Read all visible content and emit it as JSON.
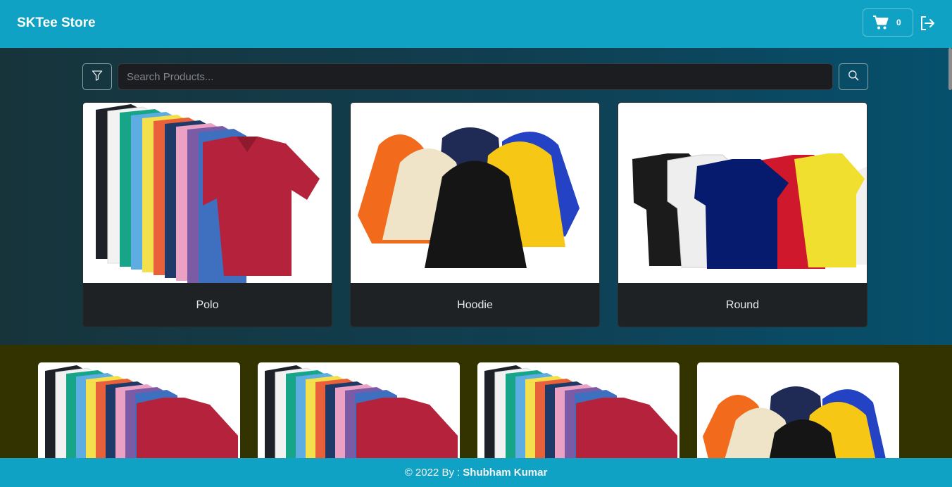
{
  "navbar": {
    "brand": "SKTee Store",
    "cart_count": "0"
  },
  "search": {
    "placeholder": "Search Products..."
  },
  "categories": [
    {
      "label": "Polo",
      "image": "polo-shirts-image"
    },
    {
      "label": "Hoodie",
      "image": "hoodies-image"
    },
    {
      "label": "Round",
      "image": "round-neck-tshirts-image"
    }
  ],
  "products": [
    {
      "image": "polo-shirts-image"
    },
    {
      "image": "polo-shirts-image"
    },
    {
      "image": "polo-shirts-image"
    },
    {
      "image": "hoodies-image"
    }
  ],
  "footer": {
    "prefix": "© 2022 By :",
    "author": "Shubham Kumar"
  },
  "colors": {
    "navbar": "#0fa2c4",
    "hero_start": "#17343b",
    "hero_end": "#06506d",
    "products_bg": "#333300",
    "card_dark": "#1f2225"
  }
}
